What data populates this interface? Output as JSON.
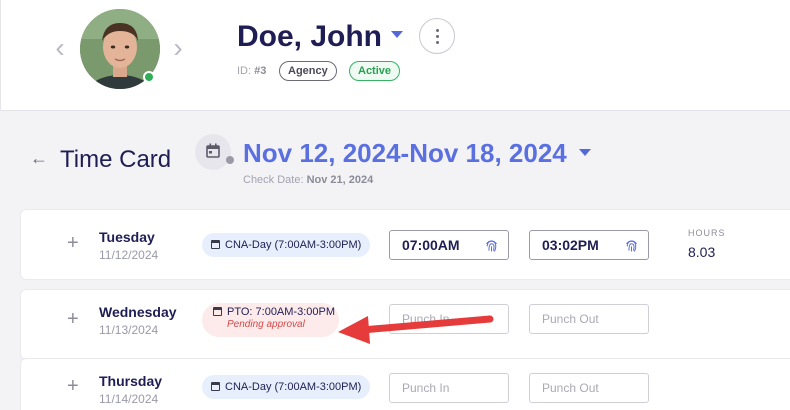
{
  "employee": {
    "name": "Doe, John",
    "id_label": "ID:",
    "id_value": "#3",
    "badges": {
      "agency": "Agency",
      "active": "Active"
    }
  },
  "nav": {
    "prev_icon": "chevron-left-icon",
    "next_icon": "chevron-right-icon",
    "prev_glyph": "‹",
    "next_glyph": "›"
  },
  "timecard": {
    "back_glyph": "←",
    "title": "Time Card",
    "date_range": "Nov 12, 2024-Nov 18, 2024",
    "check_date_label": "Check Date:",
    "check_date_value": "Nov 21, 2024"
  },
  "days": [
    {
      "day": "Tuesday",
      "date": "11/12/2024",
      "shift": "CNA-Day (7:00AM-3:00PM)",
      "punch_in": "07:00AM",
      "punch_out": "03:02PM",
      "hours_label": "HOURS",
      "hours": "8.03"
    },
    {
      "day": "Wednesday",
      "date": "11/13/2024",
      "pto": "PTO: 7:00AM-3:00PM",
      "pto_status": "Pending approval",
      "punch_in_placeholder": "Punch In",
      "punch_out_placeholder": "Punch Out"
    },
    {
      "day": "Thursday",
      "date": "11/14/2024",
      "shift": "CNA-Day (7:00AM-3:00PM)",
      "punch_in_placeholder": "Punch In",
      "punch_out_placeholder": "Punch Out"
    }
  ],
  "plus_glyph": "+",
  "colors": {
    "brand_navy": "#1f1e54",
    "accent_blue": "#5a6fe0",
    "active_green": "#2a9f52",
    "pto_red": "#d24a4a",
    "annotation_arrow": "#e53b3b"
  }
}
